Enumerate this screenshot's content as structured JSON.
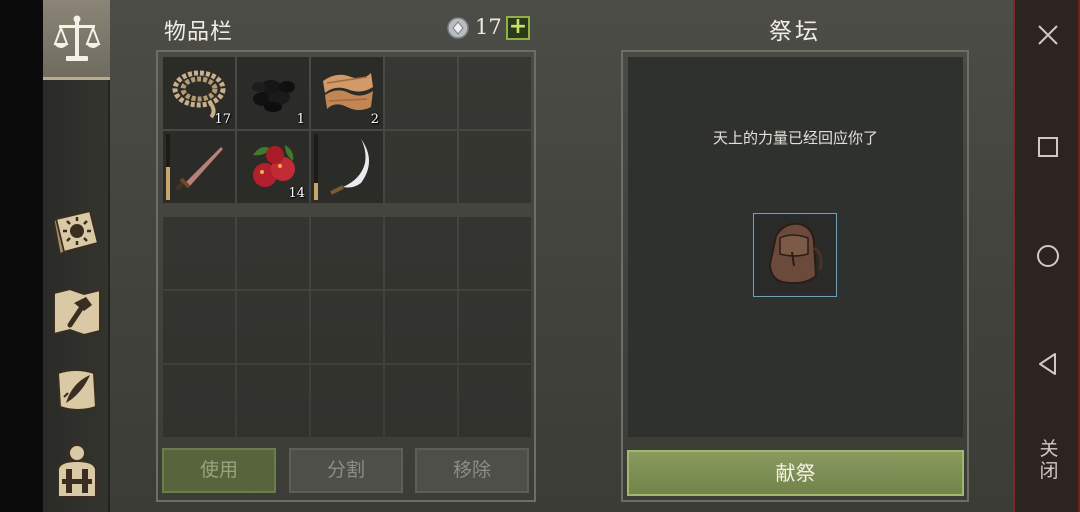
{
  "inventory": {
    "title": "物品栏",
    "currency_count": "17",
    "add_label": "+",
    "items": [
      {
        "name": "rope",
        "quantity": "17",
        "durability": null
      },
      {
        "name": "coal",
        "quantity": "1",
        "durability": null
      },
      {
        "name": "cloth",
        "quantity": "2",
        "durability": null
      },
      {
        "name": "dagger",
        "quantity": "",
        "durability": 0.5
      },
      {
        "name": "berries",
        "quantity": "14",
        "durability": null
      },
      {
        "name": "sickle",
        "quantity": "",
        "durability": 0.25
      }
    ],
    "buttons": {
      "use": "使用",
      "split": "分割",
      "remove": "移除"
    }
  },
  "altar": {
    "title": "祭坛",
    "message": "天上的力量已经回应你了",
    "slot_item": "backpack",
    "offer_label": "献祭"
  },
  "side_tabs": [
    "scales-icon",
    "sun-book-icon",
    "hammer-map-icon",
    "quill-scroll-icon",
    "backpack-character-icon"
  ],
  "system_bar": {
    "close_label": "关闭"
  },
  "colors": {
    "accent_green": "#93b046",
    "offer_button": "#7f9153",
    "slot_border": "#6fa0b6"
  }
}
